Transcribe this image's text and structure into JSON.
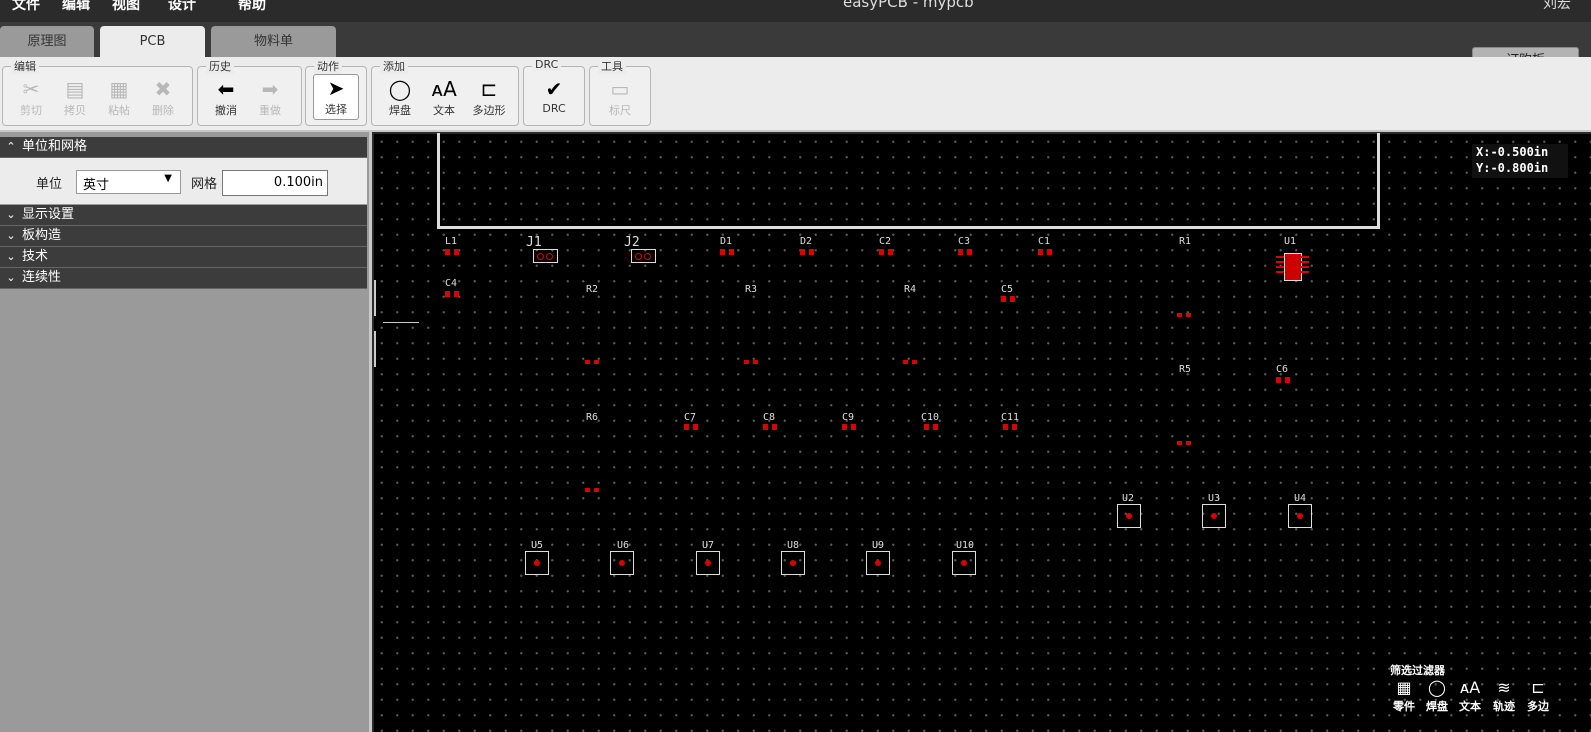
{
  "menu": {
    "items": [
      "文件",
      "编辑",
      "视图",
      "设计",
      "帮助"
    ],
    "title": "easyPCB - mypcb",
    "user": "刘宏"
  },
  "tabs": [
    "原理图",
    "PCB",
    "物料单"
  ],
  "order_button": "订购板",
  "toolbar": {
    "groups": [
      {
        "label": "编辑",
        "buttons": [
          "剪切",
          "拷贝",
          "粘帖",
          "删除"
        ]
      },
      {
        "label": "历史",
        "buttons": [
          "撤消",
          "重做"
        ]
      },
      {
        "label": "动作",
        "buttons": [
          "选择"
        ]
      },
      {
        "label": "添加",
        "buttons": [
          "焊盘",
          "文本",
          "多边形"
        ]
      },
      {
        "label": "DRC",
        "buttons": [
          "DRC"
        ]
      },
      {
        "label": "工具",
        "buttons": [
          "标尺"
        ]
      }
    ]
  },
  "panel": {
    "units_section": "单位和网格",
    "unit_label": "单位",
    "unit_value": "英寸",
    "grid_label": "网格",
    "grid_value": "0.100in",
    "sections": [
      "显示设置",
      "板构造",
      "技术",
      "连续性"
    ]
  },
  "coords": {
    "x": "X:-0.500in",
    "y": "Y:-0.800in"
  },
  "components": [
    "L1",
    "J1",
    "J2",
    "D1",
    "D2",
    "C2",
    "C3",
    "C1",
    "R1",
    "U1",
    "C4",
    "R2",
    "R3",
    "R4",
    "C5",
    "R5",
    "C6",
    "R6",
    "C7",
    "C8",
    "C9",
    "C10",
    "C11",
    "U2",
    "U3",
    "U4",
    "U5",
    "U6",
    "U7",
    "U8",
    "U9",
    "U10"
  ],
  "filter": {
    "title": "筛选过滤器",
    "items": [
      "零件",
      "焊盘",
      "文本",
      "轨迹",
      "多边"
    ]
  },
  "colors": {
    "canvas": "#000000",
    "pad": "#dd0000",
    "board_outline": "#dddddd",
    "panel": "#9a9a9a"
  }
}
